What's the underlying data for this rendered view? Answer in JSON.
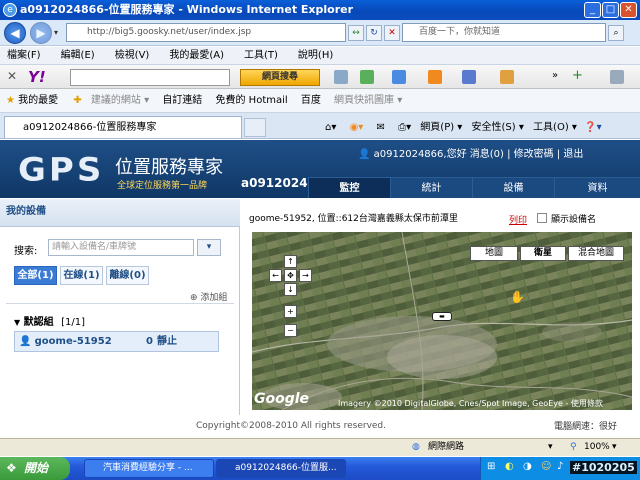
{
  "window": {
    "title": "a0912024866-位置服務專家 - Windows Internet Explorer"
  },
  "address": {
    "url": "http://big5.goosky.net/user/index.jsp",
    "search_placeholder": "百度一下，你就知道"
  },
  "menu": [
    "檔案(F)",
    "編輯(E)",
    "檢視(V)",
    "我的最愛(A)",
    "工具(T)",
    "說明(H)"
  ],
  "yahoo": {
    "logo": "Y!",
    "button": "網頁搜尋"
  },
  "favorites": {
    "label": "我的最愛",
    "items": [
      "建議的網站 ▾",
      "自訂連結",
      "免費的 Hotmail",
      "百度",
      "網頁快訊圖庫 ▾"
    ]
  },
  "tab": {
    "title": "a0912024866-位置服務專家"
  },
  "tab_tools": {
    "page": "網頁(P) ▾",
    "safety": "安全性(S) ▾",
    "tools": "工具(O) ▾",
    "help": "❓▾"
  },
  "gps": {
    "logo": "GPS",
    "title": "位置服務專家",
    "subtitle": "全球定位服務第一品牌",
    "account": "a0912024866",
    "links": "a0912024866,您好 消息(0) | 修改密碼 | 退出",
    "tabs": [
      "監控",
      "統計",
      "設備",
      "資料"
    ]
  },
  "devices": {
    "heading": "我的設備",
    "search_label": "搜索:",
    "search_placeholder": "請輸入設備名/車牌號",
    "search_btn": "▾",
    "filters": [
      "全部(1)",
      "在線(1)",
      "離線(0)"
    ],
    "add_group": "添加組",
    "group": {
      "name": "默認組",
      "count": "[1/1]"
    },
    "device": {
      "name": "goome-51952",
      "speed": "0",
      "status": "靜止"
    }
  },
  "map": {
    "location": "goome-51952, 位置::612台灣嘉義縣太保市前潭里",
    "print": "列印",
    "show_names": "顯示設備名",
    "types": [
      "地圖",
      "衛星",
      "混合地圖"
    ],
    "active_type": "衛星",
    "google": "Google",
    "credit": "Imagery ©2010 DigitalGlobe, Cnes/Spot Image, GeoEye - 使用條款"
  },
  "footer": {
    "copyright": "Copyright©2008-2010 All rights reserved.",
    "network": "電腦網速：很好"
  },
  "status": {
    "zone": "網際網路",
    "zoom": "100%"
  },
  "taskbar": {
    "start": "開始",
    "tasks": [
      "汽車消費經驗分享 - ...",
      "a0912024866-位置服..."
    ],
    "id": "#1020205"
  },
  "colors": {
    "gps_header": "#1f4f87",
    "xp_blue": "#2459d8",
    "accent_yellow": "#ffd65a"
  }
}
